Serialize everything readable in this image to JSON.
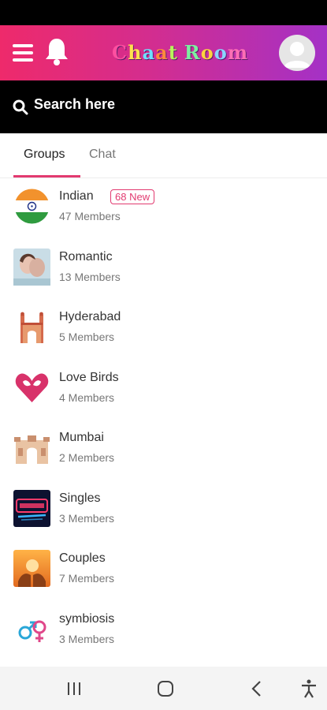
{
  "app": {
    "title_letters": [
      "C",
      "h",
      "a",
      "a",
      "t",
      " ",
      "R",
      "o",
      "o",
      "m"
    ],
    "title_colors": [
      "#ff4fa0",
      "#ffe14d",
      "#6ee0ff",
      "#ff8a3d",
      "#b8f55a",
      "#ffffff",
      "#7cf0a0",
      "#ffd23f",
      "#8ad4ff",
      "#ff6fb5"
    ]
  },
  "search": {
    "placeholder": "Search here"
  },
  "tabs": [
    {
      "label": "Groups"
    },
    {
      "label": "Chat"
    }
  ],
  "groups": [
    {
      "name": "Indian",
      "members": "47 Members",
      "badge": "68 New",
      "icon": "india-flag-icon"
    },
    {
      "name": "Romantic",
      "members": "13 Members",
      "icon": "romantic-couple-photo"
    },
    {
      "name": "Hyderabad",
      "members": "5 Members",
      "icon": "charminar-icon"
    },
    {
      "name": "Love Birds",
      "members": "4 Members",
      "icon": "heart-doves-icon"
    },
    {
      "name": "Mumbai",
      "members": "2 Members",
      "icon": "gateway-of-india-icon"
    },
    {
      "name": "Singles",
      "members": "3 Members",
      "icon": "singles-neon-sign-icon"
    },
    {
      "name": "Couples",
      "members": "7 Members",
      "icon": "couple-sunset-icon"
    },
    {
      "name": "symbiosis",
      "members": "3 Members",
      "icon": "gender-symbols-icon"
    }
  ],
  "colors": {
    "accent": "#e23a70",
    "gradient_start": "#ee2a6b",
    "gradient_end": "#a431c6"
  }
}
